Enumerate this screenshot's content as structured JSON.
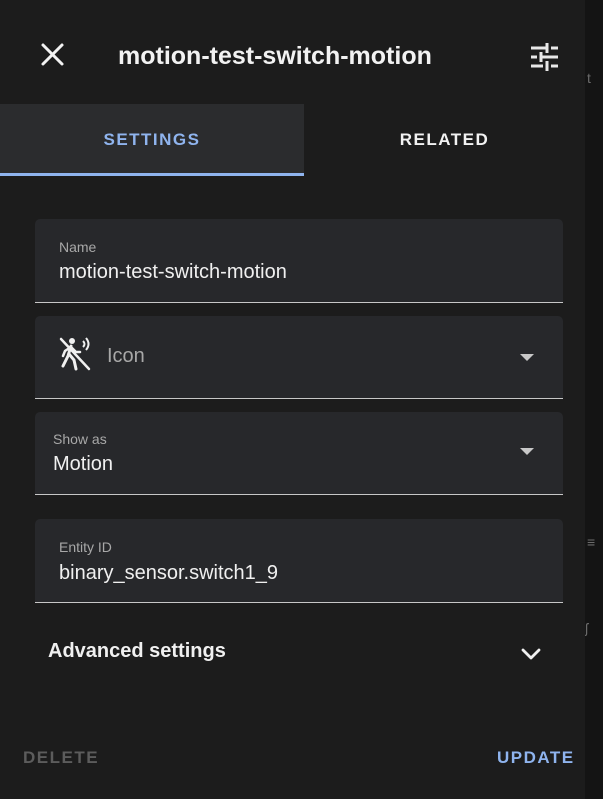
{
  "header": {
    "title": "motion-test-switch-motion",
    "close_icon": "close-icon",
    "settings_icon": "tune-icon"
  },
  "tabs": [
    {
      "label": "SETTINGS",
      "active": true
    },
    {
      "label": "RELATED",
      "active": false
    }
  ],
  "form": {
    "name": {
      "label": "Name",
      "value": "motion-test-switch-motion"
    },
    "icon": {
      "placeholder": "Icon",
      "icon": "motion-sensor-icon"
    },
    "show_as": {
      "label": "Show as",
      "value": "Motion"
    },
    "entity_id": {
      "label": "Entity ID",
      "value": "binary_sensor.switch1_9"
    }
  },
  "advanced": {
    "label": "Advanced settings"
  },
  "footer": {
    "delete_label": "DELETE",
    "update_label": "UPDATE"
  },
  "colors": {
    "accent": "#8fb4ee",
    "dialog_bg": "#1c1c1c",
    "field_bg": "#27282b",
    "disabled": "#5c5c5c"
  }
}
